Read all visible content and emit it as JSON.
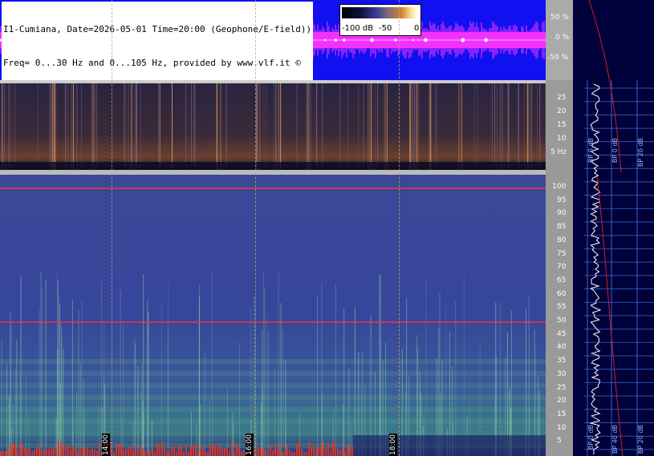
{
  "header": {
    "caption_line1": "I1-Cumiana, Date=2026-05-01 Time=20:00 (Geophone/E-field))",
    "caption_line2": "Freq= 0...30 Hz and 0...105 Hz, provided by www.vlf.it ©"
  },
  "colorbar": {
    "labels": [
      "-100 dB",
      "-50",
      "0"
    ]
  },
  "waveform_axis": {
    "ticks": [
      "50 %",
      "0 %",
      "-50 %"
    ]
  },
  "spectrogram_low": {
    "ticks": [
      "25",
      "20",
      "15",
      "10",
      "5 Hz"
    ]
  },
  "spectrogram_high": {
    "ticks": [
      "100",
      "95",
      "90",
      "85",
      "80",
      "75",
      "70",
      "65",
      "60",
      "55",
      "50",
      "45",
      "40",
      "35",
      "30",
      "25",
      "20",
      "15",
      "10",
      "5"
    ]
  },
  "time_labels": [
    "14:00",
    "16:00",
    "18:00"
  ],
  "side_panel": {
    "bp_labels_top": [
      "BP 0 dB",
      "BP 0 dB",
      "BP 20 dB"
    ],
    "bp_labels_bottom": [
      "BP 0 dB",
      "BP 40 dB",
      "BP 20 dB"
    ]
  },
  "colors": {
    "waveform_bg": "#1010f0",
    "waveform_trace": "#ff33ff",
    "mains_line": "#ff3030"
  }
}
